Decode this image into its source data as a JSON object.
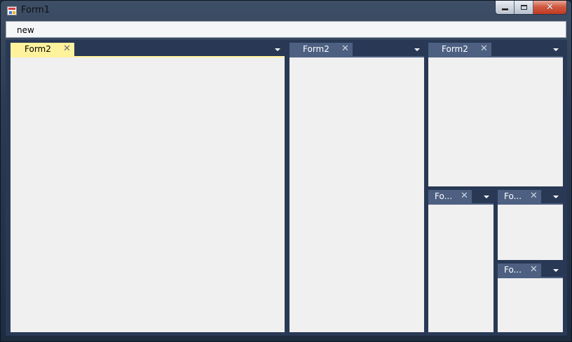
{
  "window": {
    "title": "Form1",
    "controls": {
      "minimize_icon": "minimize-icon",
      "maximize_icon": "maximize-icon",
      "close_icon": "close-icon"
    }
  },
  "menu": {
    "items": [
      {
        "label": "new"
      }
    ]
  },
  "docs": [
    {
      "tab_label": "Form2",
      "active": true
    },
    {
      "tab_label": "Form2",
      "active": false
    },
    {
      "tab_label": "Form2",
      "active": false
    },
    {
      "tab_label": "Fo...",
      "active": false
    },
    {
      "tab_label": "Fo...",
      "active": false
    },
    {
      "tab_label": "Fo...",
      "active": false
    }
  ],
  "glyphs": {
    "close": "✕"
  },
  "colors": {
    "dock_background": "#293955",
    "tab_inactive": "#4d6082",
    "tab_active": "#fff29d",
    "content": "#f0f0f0"
  }
}
